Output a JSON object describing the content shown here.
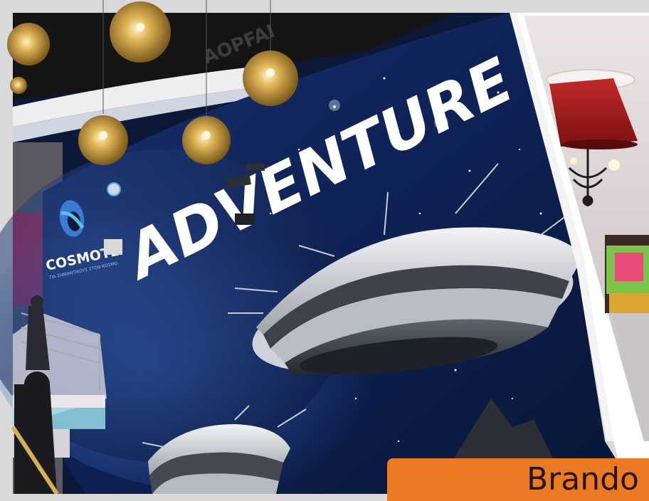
{
  "photo": {
    "wall_text": "ADVENTURE",
    "logo_text": "COSMOTE",
    "logo_tagline": "ΓΙΑ ΣΗΜΑΝΤΙΚΟΥΣ ΣΤΟΝ ΚΟΣΜΟ",
    "ceiling_text": "AOPFAI"
  },
  "caption": {
    "label": "Brando",
    "color": "#ec7a25"
  }
}
